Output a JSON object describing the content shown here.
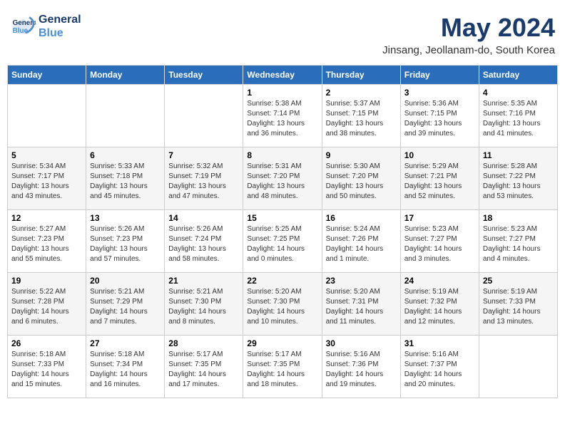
{
  "logo": {
    "line1": "General",
    "line2": "Blue"
  },
  "title": "May 2024",
  "subtitle": "Jinsang, Jeollanam-do, South Korea",
  "days_of_week": [
    "Sunday",
    "Monday",
    "Tuesday",
    "Wednesday",
    "Thursday",
    "Friday",
    "Saturday"
  ],
  "weeks": [
    [
      {
        "day": "",
        "info": ""
      },
      {
        "day": "",
        "info": ""
      },
      {
        "day": "",
        "info": ""
      },
      {
        "day": "1",
        "info": "Sunrise: 5:38 AM\nSunset: 7:14 PM\nDaylight: 13 hours and 36 minutes."
      },
      {
        "day": "2",
        "info": "Sunrise: 5:37 AM\nSunset: 7:15 PM\nDaylight: 13 hours and 38 minutes."
      },
      {
        "day": "3",
        "info": "Sunrise: 5:36 AM\nSunset: 7:15 PM\nDaylight: 13 hours and 39 minutes."
      },
      {
        "day": "4",
        "info": "Sunrise: 5:35 AM\nSunset: 7:16 PM\nDaylight: 13 hours and 41 minutes."
      }
    ],
    [
      {
        "day": "5",
        "info": "Sunrise: 5:34 AM\nSunset: 7:17 PM\nDaylight: 13 hours and 43 minutes."
      },
      {
        "day": "6",
        "info": "Sunrise: 5:33 AM\nSunset: 7:18 PM\nDaylight: 13 hours and 45 minutes."
      },
      {
        "day": "7",
        "info": "Sunrise: 5:32 AM\nSunset: 7:19 PM\nDaylight: 13 hours and 47 minutes."
      },
      {
        "day": "8",
        "info": "Sunrise: 5:31 AM\nSunset: 7:20 PM\nDaylight: 13 hours and 48 minutes."
      },
      {
        "day": "9",
        "info": "Sunrise: 5:30 AM\nSunset: 7:20 PM\nDaylight: 13 hours and 50 minutes."
      },
      {
        "day": "10",
        "info": "Sunrise: 5:29 AM\nSunset: 7:21 PM\nDaylight: 13 hours and 52 minutes."
      },
      {
        "day": "11",
        "info": "Sunrise: 5:28 AM\nSunset: 7:22 PM\nDaylight: 13 hours and 53 minutes."
      }
    ],
    [
      {
        "day": "12",
        "info": "Sunrise: 5:27 AM\nSunset: 7:23 PM\nDaylight: 13 hours and 55 minutes."
      },
      {
        "day": "13",
        "info": "Sunrise: 5:26 AM\nSunset: 7:23 PM\nDaylight: 13 hours and 57 minutes."
      },
      {
        "day": "14",
        "info": "Sunrise: 5:26 AM\nSunset: 7:24 PM\nDaylight: 13 hours and 58 minutes."
      },
      {
        "day": "15",
        "info": "Sunrise: 5:25 AM\nSunset: 7:25 PM\nDaylight: 14 hours and 0 minutes."
      },
      {
        "day": "16",
        "info": "Sunrise: 5:24 AM\nSunset: 7:26 PM\nDaylight: 14 hours and 1 minute."
      },
      {
        "day": "17",
        "info": "Sunrise: 5:23 AM\nSunset: 7:27 PM\nDaylight: 14 hours and 3 minutes."
      },
      {
        "day": "18",
        "info": "Sunrise: 5:23 AM\nSunset: 7:27 PM\nDaylight: 14 hours and 4 minutes."
      }
    ],
    [
      {
        "day": "19",
        "info": "Sunrise: 5:22 AM\nSunset: 7:28 PM\nDaylight: 14 hours and 6 minutes."
      },
      {
        "day": "20",
        "info": "Sunrise: 5:21 AM\nSunset: 7:29 PM\nDaylight: 14 hours and 7 minutes."
      },
      {
        "day": "21",
        "info": "Sunrise: 5:21 AM\nSunset: 7:30 PM\nDaylight: 14 hours and 8 minutes."
      },
      {
        "day": "22",
        "info": "Sunrise: 5:20 AM\nSunset: 7:30 PM\nDaylight: 14 hours and 10 minutes."
      },
      {
        "day": "23",
        "info": "Sunrise: 5:20 AM\nSunset: 7:31 PM\nDaylight: 14 hours and 11 minutes."
      },
      {
        "day": "24",
        "info": "Sunrise: 5:19 AM\nSunset: 7:32 PM\nDaylight: 14 hours and 12 minutes."
      },
      {
        "day": "25",
        "info": "Sunrise: 5:19 AM\nSunset: 7:33 PM\nDaylight: 14 hours and 13 minutes."
      }
    ],
    [
      {
        "day": "26",
        "info": "Sunrise: 5:18 AM\nSunset: 7:33 PM\nDaylight: 14 hours and 15 minutes."
      },
      {
        "day": "27",
        "info": "Sunrise: 5:18 AM\nSunset: 7:34 PM\nDaylight: 14 hours and 16 minutes."
      },
      {
        "day": "28",
        "info": "Sunrise: 5:17 AM\nSunset: 7:35 PM\nDaylight: 14 hours and 17 minutes."
      },
      {
        "day": "29",
        "info": "Sunrise: 5:17 AM\nSunset: 7:35 PM\nDaylight: 14 hours and 18 minutes."
      },
      {
        "day": "30",
        "info": "Sunrise: 5:16 AM\nSunset: 7:36 PM\nDaylight: 14 hours and 19 minutes."
      },
      {
        "day": "31",
        "info": "Sunrise: 5:16 AM\nSunset: 7:37 PM\nDaylight: 14 hours and 20 minutes."
      },
      {
        "day": "",
        "info": ""
      }
    ]
  ]
}
